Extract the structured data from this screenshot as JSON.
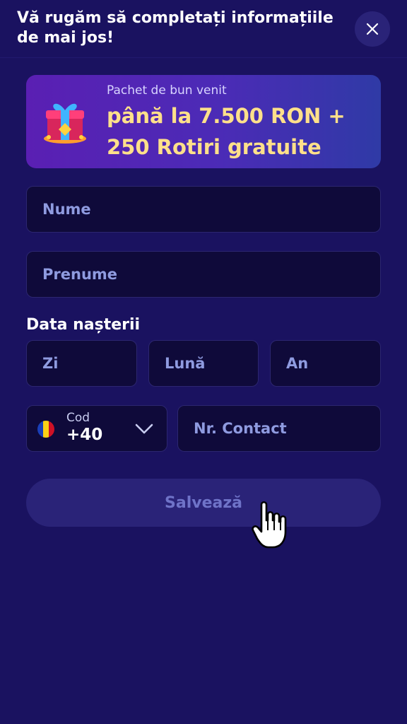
{
  "header": {
    "title": "Vă rugăm să completați informațiile de mai jos!",
    "close_icon": "close-icon"
  },
  "banner": {
    "subtitle": "Pachet de bun venit",
    "headline": "până la 7.500 RON + 250 Rotiri gratuite",
    "icon": "gift-box-icon"
  },
  "form": {
    "first_name_placeholder": "Nume",
    "last_name_placeholder": "Prenume",
    "dob_label": "Data nașterii",
    "day_placeholder": "Zi",
    "month_placeholder": "Lună",
    "year_placeholder": "An",
    "phone": {
      "code_label": "Cod",
      "code_value": "+40",
      "number_placeholder": "Nr. Contact",
      "flag_icon": "romania-flag-icon"
    },
    "save_label": "Salvează"
  },
  "colors": {
    "background": "#1a1260",
    "field_bg": "#0f0a3a",
    "accent_yellow": "#ffe08a",
    "placeholder": "#8f9be0",
    "button_disabled": "#2a2378"
  }
}
